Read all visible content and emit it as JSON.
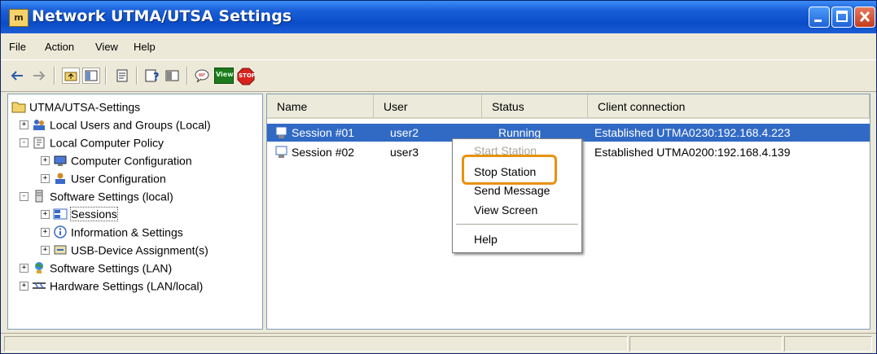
{
  "window": {
    "title": "Network UTMA/UTSA Settings",
    "app_icon": "utma-app-icon"
  },
  "menubar": {
    "items": [
      "File",
      "Action",
      "View",
      "Help"
    ]
  },
  "toolbar": {
    "icons": [
      "back-arrow-icon",
      "forward-arrow-icon",
      "up-folder-icon",
      "show-hide-tree-icon",
      "export-list-icon",
      "help-icon",
      "console-tree-icon",
      "send-message-icon",
      "view-screen-icon",
      "stop-station-icon"
    ],
    "view_label": "View",
    "stop_label": "STOP"
  },
  "tree": {
    "root": "UTMA/UTSA-Settings",
    "items": [
      {
        "label": "Local Users and Groups (Local)",
        "expander": "+"
      },
      {
        "label": "Local Computer Policy",
        "expander": "-"
      },
      {
        "label": "Computer Configuration",
        "expander": "+"
      },
      {
        "label": "User Configuration",
        "expander": "+"
      },
      {
        "label": "Software Settings (local)",
        "expander": "-"
      },
      {
        "label": "Sessions",
        "expander": "+"
      },
      {
        "label": "Information & Settings",
        "expander": "+"
      },
      {
        "label": "USB-Device Assignment(s)",
        "expander": "+"
      },
      {
        "label": "Software Settings (LAN)",
        "expander": "+"
      },
      {
        "label": "Hardware Settings (LAN/local)",
        "expander": "+"
      }
    ]
  },
  "list": {
    "columns": [
      "Name",
      "User",
      "Status",
      "Client connection"
    ],
    "rows": [
      {
        "name": "Session #01",
        "user": "user2",
        "status": "Running",
        "connection": "Established UTMA0230:192.168.4.223"
      },
      {
        "name": "Session #02",
        "user": "user3",
        "status": "",
        "connection": "Established UTMA0200:192.168.4.139"
      }
    ]
  },
  "context_menu": {
    "items": [
      "Start Station",
      "Stop Station",
      "Send Message",
      "View Screen",
      "Help"
    ]
  },
  "colors": {
    "title_bar": "#0a4cc8",
    "selection": "#316ac5",
    "highlight": "#e8910f"
  }
}
